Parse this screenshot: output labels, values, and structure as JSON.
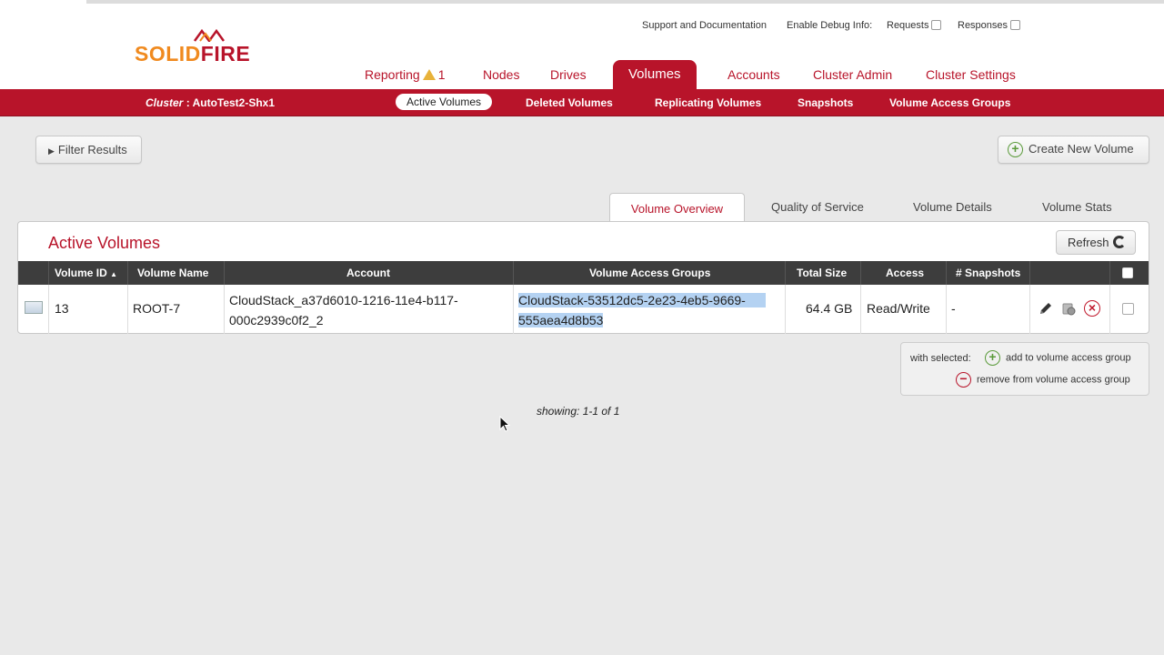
{
  "brand": {
    "logo_solid": "SOLID",
    "logo_fire": "FIRE",
    "accent": "#b8142a",
    "orange": "#f08a1f"
  },
  "utility": {
    "support": "Support and Documentation",
    "debug_label": "Enable Debug Info:",
    "requests": "Requests",
    "responses": "Responses"
  },
  "mainnav": {
    "reporting": "Reporting",
    "reporting_count": "1",
    "nodes": "Nodes",
    "drives": "Drives",
    "volumes": "Volumes",
    "accounts": "Accounts",
    "cluster_admin": "Cluster Admin",
    "cluster_settings": "Cluster Settings"
  },
  "subnav": {
    "cluster_label": "Cluster",
    "cluster_name": ": AutoTest2-Shx1",
    "active_volumes": "Active Volumes",
    "deleted_volumes": "Deleted Volumes",
    "replicating_volumes": "Replicating Volumes",
    "snapshots": "Snapshots",
    "volume_access_groups": "Volume Access Groups"
  },
  "toolbar": {
    "filter": "Filter Results",
    "create": "Create New Volume"
  },
  "tabs": {
    "overview": "Volume Overview",
    "qos": "Quality of Service",
    "details": "Volume Details",
    "stats": "Volume Stats"
  },
  "panel": {
    "title": "Active Volumes",
    "refresh": "Refresh"
  },
  "table": {
    "columns": {
      "volume_id": "Volume ID",
      "volume_name": "Volume Name",
      "account": "Account",
      "vag": "Volume Access Groups",
      "total_size": "Total Size",
      "access": "Access",
      "snapshots": "# Snapshots"
    },
    "rows": [
      {
        "volume_id": "13",
        "volume_name": "ROOT-7",
        "account_line1": "CloudStack_a37d6010-1216-11e4-b117-",
        "account_line2": "000c2939c0f2_2",
        "vag_line1": "CloudStack-53512dc5-2e23-4eb5-9669-",
        "vag_line2": "555aea4d8b53",
        "total_size": "64.4 GB",
        "access": "Read/Write",
        "snapshots": "-"
      }
    ]
  },
  "with_selected": {
    "label": "with selected:",
    "add": "add to volume access group",
    "remove": "remove from volume access group"
  },
  "footer": {
    "showing": "showing: 1-1 of 1"
  }
}
